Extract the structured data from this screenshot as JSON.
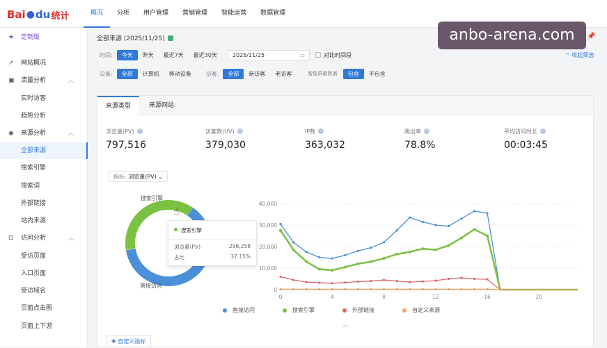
{
  "brand": {
    "name_a": "Bai",
    "name_b": "du",
    "name_c": "统计"
  },
  "topnav": [
    "概况",
    "分析",
    "用户管理",
    "营销管理",
    "智能运营",
    "数据管理"
  ],
  "watermark": "anbo-arena.com",
  "sidebar": {
    "custom": "定制版",
    "items": [
      {
        "label": "网站概况",
        "icon": "trend-icon"
      },
      {
        "label": "流量分析",
        "icon": "traffic-icon",
        "chev": "⌃"
      },
      {
        "label": "实时访客"
      },
      {
        "label": "趋势分析"
      },
      {
        "label": "来源分析",
        "icon": "compass-icon",
        "chev": "⌃"
      },
      {
        "label": "全部来源"
      },
      {
        "label": "搜索引擎"
      },
      {
        "label": "搜索词"
      },
      {
        "label": "外部链接"
      },
      {
        "label": "站内来源"
      },
      {
        "label": "访问分析",
        "icon": "visit-icon",
        "chev": "⌃"
      },
      {
        "label": "受访页面"
      },
      {
        "label": "入口页面"
      },
      {
        "label": "受访域名"
      },
      {
        "label": "页面点击图"
      },
      {
        "label": "页面上下游"
      }
    ]
  },
  "header": {
    "title": "全部来源 (2025/11/25)"
  },
  "filters": {
    "time_label": "时间:",
    "time_opts": [
      "今天",
      "昨天",
      "最近7天",
      "最近30天"
    ],
    "date": "2025/11/25",
    "compare": "对比时间段",
    "device_label": "设备:",
    "device_opts": [
      "全部",
      "计算机",
      "移动设备"
    ],
    "visitor_label": "访客:",
    "visitor_opts": [
      "全部",
      "新访客",
      "老访客"
    ],
    "smart_label": "智能屏蔽数据:",
    "smart_opts": [
      "包含",
      "不包含"
    ],
    "collapse": "^ 收起筛选"
  },
  "tabs": [
    "来源类型",
    "来源网站"
  ],
  "metrics": [
    {
      "label": "浏览量(PV)",
      "value": "797,516"
    },
    {
      "label": "访客数(UV)",
      "value": "379,030"
    },
    {
      "label": "IP数",
      "value": "363,032"
    },
    {
      "label": "跳出率",
      "value": "78.8%"
    },
    {
      "label": "平均访问时长",
      "value": "00:03:45"
    }
  ],
  "indicator": {
    "label": "指标:",
    "value": "浏览量(PV)"
  },
  "tooltip": {
    "title": "搜索引擎",
    "pv_label": "浏览量(PV)",
    "pv": "296,258",
    "share_label": "占比",
    "share": "37.15%"
  },
  "donut_labels": {
    "top": "搜索引擎",
    "bottom": "直接访问"
  },
  "custom_btn": "自定义指标",
  "colors": {
    "direct": "#4a90d9",
    "search": "#7cc242",
    "external": "#e06666",
    "custom": "#f0a060",
    "accent": "#2f7ad8"
  },
  "chart_data": [
    {
      "type": "pie",
      "title": "",
      "values": [
        {
          "name": "搜索引擎",
          "value": 296258,
          "share": 37.15
        }
      ],
      "donut": true
    },
    {
      "type": "line",
      "x": [
        0,
        1,
        2,
        3,
        4,
        5,
        6,
        7,
        8,
        9,
        10,
        11,
        12,
        13,
        14,
        15,
        16,
        17,
        18,
        19,
        20,
        21,
        22,
        23
      ],
      "ylim": [
        0,
        40000
      ],
      "yticks": [
        "0",
        "10,000",
        "20,000",
        "30,000",
        "40,000"
      ],
      "xticks": [
        "0",
        "4",
        "8",
        "12",
        "16",
        "20"
      ],
      "series": [
        {
          "name": "直接访问",
          "color": "#4a90d9",
          "values": [
            30500,
            22000,
            17500,
            15000,
            14500,
            16000,
            18000,
            19500,
            22000,
            27500,
            33500,
            31500,
            30000,
            29500,
            33000,
            36500,
            35500,
            null,
            null,
            null,
            null,
            null,
            null,
            null
          ]
        },
        {
          "name": "搜索引擎",
          "color": "#7cc242",
          "values": [
            27500,
            18500,
            13000,
            9500,
            9000,
            10500,
            12000,
            13000,
            14500,
            16500,
            17500,
            19000,
            18500,
            20500,
            24000,
            28000,
            25000,
            null,
            null,
            null,
            null,
            null,
            null,
            null
          ]
        },
        {
          "name": "外部链接",
          "color": "#e06666",
          "values": [
            6000,
            4500,
            3500,
            3200,
            3000,
            3300,
            3700,
            4000,
            4500,
            4000,
            3500,
            3800,
            4200,
            5000,
            5500,
            5000,
            4800,
            null,
            null,
            null,
            null,
            null,
            null,
            null
          ]
        },
        {
          "name": "自定义来源",
          "color": "#f0a060",
          "values": [
            200,
            200,
            200,
            200,
            200,
            200,
            200,
            200,
            200,
            200,
            200,
            200,
            200,
            200,
            200,
            200,
            200,
            null,
            null,
            null,
            null,
            null,
            null,
            null
          ]
        }
      ]
    }
  ]
}
